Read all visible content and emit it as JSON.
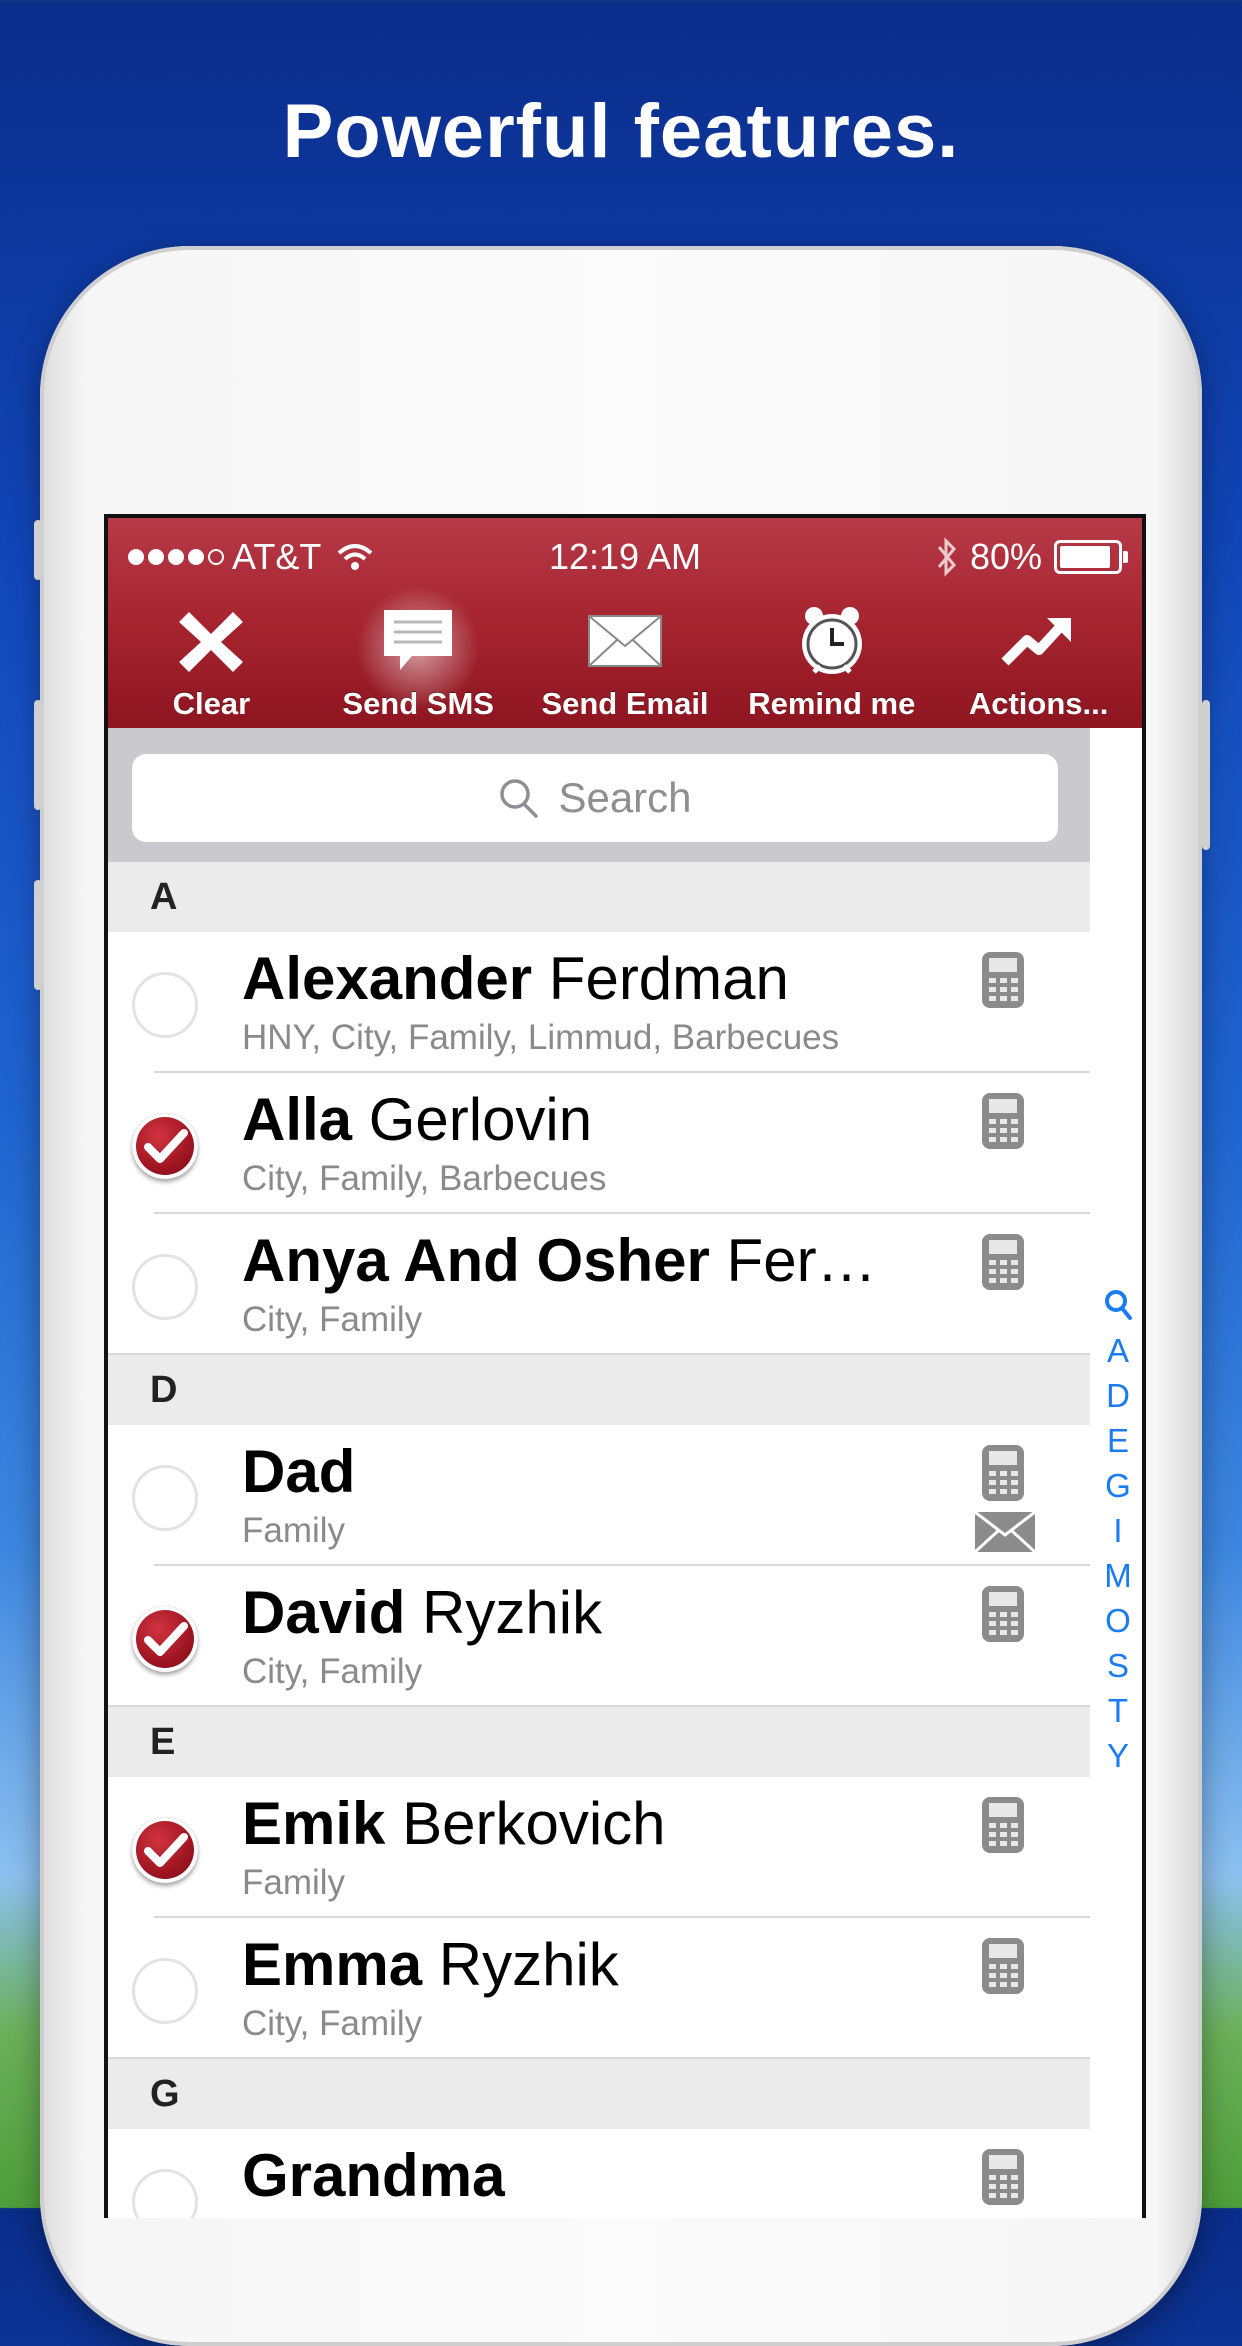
{
  "headline": "Powerful features.",
  "status": {
    "carrier": "AT&T",
    "time": "12:19 AM",
    "battery": "80%",
    "signal_bars": 4
  },
  "toolbar": {
    "clear": "Clear",
    "send_sms": "Send SMS",
    "send_email": "Send Email",
    "remind": "Remind me",
    "actions": "Actions..."
  },
  "search": {
    "placeholder": "Search"
  },
  "sections": {
    "a": "A",
    "d": "D",
    "e": "E",
    "g": "G"
  },
  "contacts": [
    {
      "first": "Alexander",
      "last": " Ferdman",
      "groups": "HNY, City, Family, Limmud, Barbecues",
      "checked": false
    },
    {
      "first": "Alla",
      "last": " Gerlovin",
      "groups": "City, Family, Barbecues",
      "checked": true
    },
    {
      "first": "Anya And Osher",
      "last": " Ferdman",
      "groups": "City, Family",
      "checked": false
    },
    {
      "first": "Dad",
      "last": "",
      "groups": "Family",
      "checked": false
    },
    {
      "first": "David",
      "last": " Ryzhik",
      "groups": "City, Family",
      "checked": true
    },
    {
      "first": "Emik",
      "last": " Berkovich",
      "groups": "Family",
      "checked": true
    },
    {
      "first": "Emma",
      "last": " Ryzhik",
      "groups": "City, Family",
      "checked": false
    },
    {
      "first": "Grandma",
      "last": "",
      "groups": "",
      "checked": false
    }
  ],
  "index_letters": [
    "A",
    "D",
    "E",
    "G",
    "I",
    "M",
    "O",
    "S",
    "T",
    "Y"
  ]
}
